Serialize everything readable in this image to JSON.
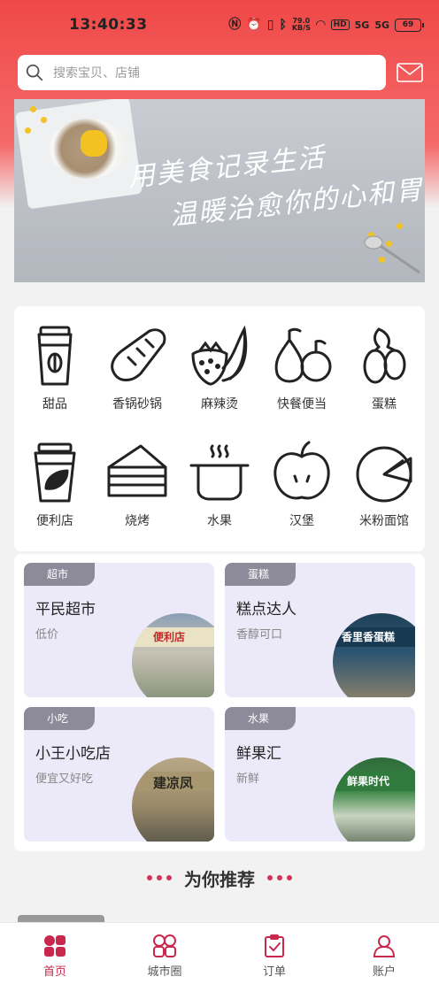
{
  "colors": {
    "accent": "#c8284e",
    "header_red": "#f04848",
    "card_purple": "#ece9f8",
    "tag_gray": "#8d8a99"
  },
  "status_bar": {
    "time": "13:40:33",
    "net_speed": "79.0",
    "net_speed_unit": "KB/S",
    "hd": "HD",
    "signal_1": "5G",
    "signal_2": "5G",
    "battery": "69"
  },
  "search": {
    "placeholder": "搜索宝贝、店铺"
  },
  "banner": {
    "line1": "用美食记录生活",
    "line2": "温暖治愈你的心和胃"
  },
  "categories": [
    {
      "label": "甜品",
      "icon": "coffee-cup-icon"
    },
    {
      "label": "香锅砂锅",
      "icon": "bread-icon"
    },
    {
      "label": "麻辣烫",
      "icon": "strawberry-banana-icon"
    },
    {
      "label": "快餐便当",
      "icon": "pear-apple-icon"
    },
    {
      "label": "蛋糕",
      "icon": "olives-icon"
    },
    {
      "label": "便利店",
      "icon": "leaf-cup-icon"
    },
    {
      "label": "烧烤",
      "icon": "cake-slice-icon"
    },
    {
      "label": "水果",
      "icon": "pot-icon"
    },
    {
      "label": "汉堡",
      "icon": "apple-icon"
    },
    {
      "label": "米粉面馆",
      "icon": "pie-icon"
    }
  ],
  "stores": [
    {
      "tag": "超市",
      "name": "平民超市",
      "desc": "低价",
      "sign": "便利店"
    },
    {
      "tag": "蛋糕",
      "name": "糕点达人",
      "desc": "香醇可口",
      "sign": "香里香蛋糕"
    },
    {
      "tag": "小吃",
      "name": "小王小吃店",
      "desc": "便宜又好吃",
      "sign": "建凉凤"
    },
    {
      "tag": "水果",
      "name": "鲜果汇",
      "desc": "新鲜",
      "sign": "鲜果时代"
    }
  ],
  "recommend": {
    "title": "为你推荐"
  },
  "tabbar": [
    {
      "label": "首页",
      "icon": "home-grid-icon",
      "active": true
    },
    {
      "label": "城市圈",
      "icon": "city-circle-icon",
      "active": false
    },
    {
      "label": "订单",
      "icon": "order-clipboard-icon",
      "active": false
    },
    {
      "label": "账户",
      "icon": "account-icon",
      "active": false
    }
  ]
}
